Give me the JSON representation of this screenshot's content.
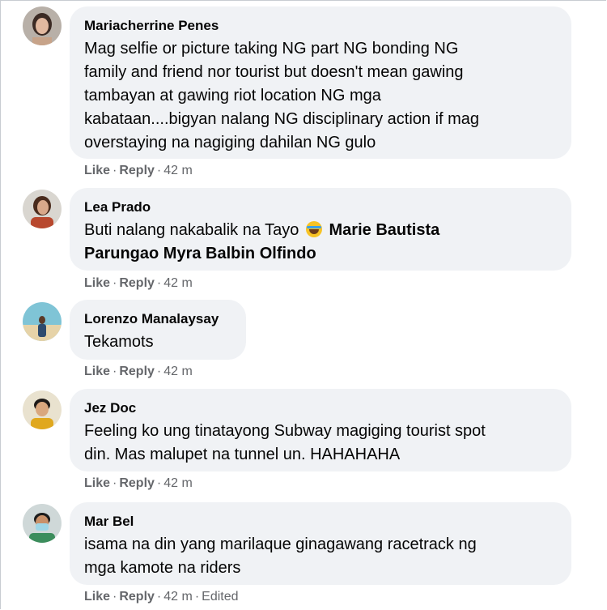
{
  "comments": [
    {
      "author": "Mariacherrine Penes",
      "text_lines": [
        "Mag selfie or picture taking NG part NG bonding NG",
        "family and friend nor tourist but doesn't mean gawing",
        "tambayan at gawing riot location NG mga",
        "kabataan....bigyan nalang NG disciplinary action if mag",
        "overstaying na nagiging dahilan NG gulo"
      ],
      "like": "Like",
      "reply": "Reply",
      "time": "42 m"
    },
    {
      "author": "Lea Prado",
      "text_start": "Buti nalang nakabalik na Tayo",
      "mention_1": "Marie Bautista",
      "mention_2": "Parungao Myra Balbin Olfindo",
      "emoji": "joy-emoji",
      "like": "Like",
      "reply": "Reply",
      "time": "42 m"
    },
    {
      "author": "Lorenzo Manalaysay",
      "text_lines": [
        "Tekamots"
      ],
      "like": "Like",
      "reply": "Reply",
      "time": "42 m"
    },
    {
      "author": "Jez Doc",
      "text_lines": [
        "Feeling ko ung tinatayong Subway magiging tourist spot",
        "din. Mas malupet na tunnel un. HAHAHAHA"
      ],
      "like": "Like",
      "reply": "Reply",
      "time": "42 m"
    },
    {
      "author": "Mar Bel",
      "text_lines": [
        "isama na din yang marilaque ginagawang racetrack ng",
        "mga kamote na riders"
      ],
      "like": "Like",
      "reply": "Reply",
      "time": "42 m",
      "edited": "Edited"
    }
  ],
  "separator": "·"
}
